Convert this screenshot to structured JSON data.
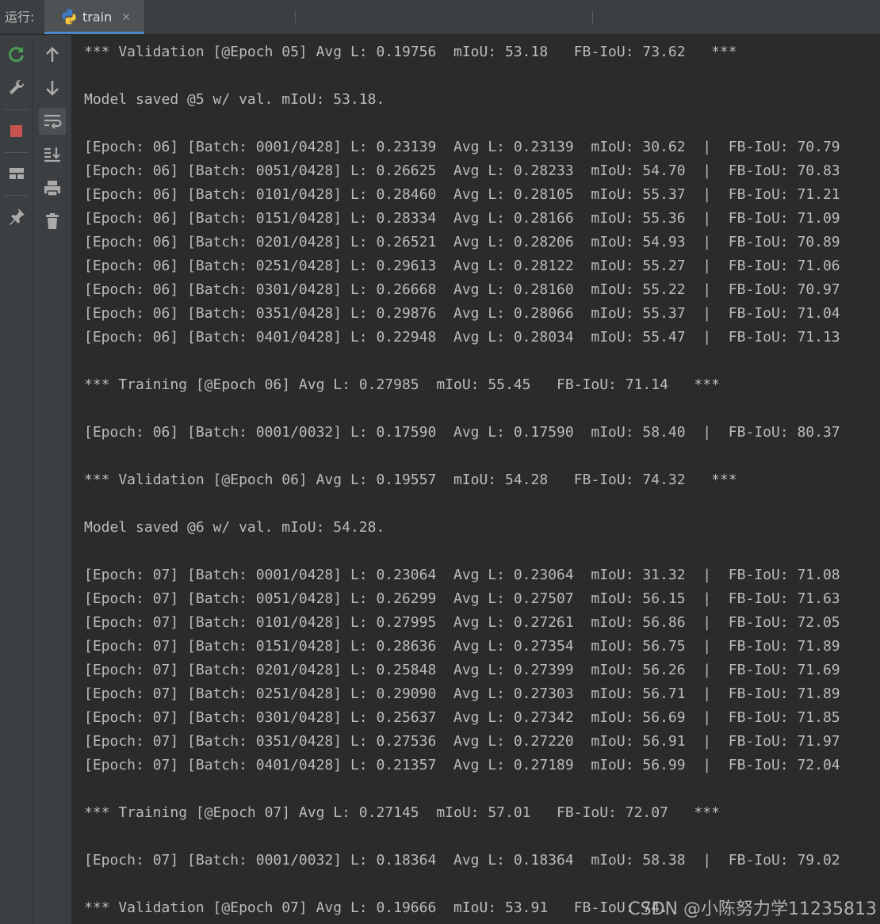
{
  "run_panel": {
    "label": "运行:",
    "tab": {
      "title": "train",
      "close": "×",
      "icon": "python-icon"
    }
  },
  "toolbar": {
    "left": [
      "rerun-icon",
      "wrench-icon",
      "stop-icon",
      "layout-icon",
      "pin-icon"
    ],
    "right": [
      "up-arrow-icon",
      "down-arrow-icon",
      "soft-wrap-icon",
      "scroll-to-end-icon",
      "print-icon",
      "trash-icon"
    ]
  },
  "console": {
    "lines": [
      "*** Validation [@Epoch 05] Avg L: 0.19756  mIoU: 53.18   FB-IoU: 73.62   ***",
      "",
      "Model saved @5 w/ val. mIoU: 53.18.",
      "",
      "[Epoch: 06] [Batch: 0001/0428] L: 0.23139  Avg L: 0.23139  mIoU: 30.62  |  FB-IoU: 70.79",
      "[Epoch: 06] [Batch: 0051/0428] L: 0.26625  Avg L: 0.28233  mIoU: 54.70  |  FB-IoU: 70.83",
      "[Epoch: 06] [Batch: 0101/0428] L: 0.28460  Avg L: 0.28105  mIoU: 55.37  |  FB-IoU: 71.21",
      "[Epoch: 06] [Batch: 0151/0428] L: 0.28334  Avg L: 0.28166  mIoU: 55.36  |  FB-IoU: 71.09",
      "[Epoch: 06] [Batch: 0201/0428] L: 0.26521  Avg L: 0.28206  mIoU: 54.93  |  FB-IoU: 70.89",
      "[Epoch: 06] [Batch: 0251/0428] L: 0.29613  Avg L: 0.28122  mIoU: 55.27  |  FB-IoU: 71.06",
      "[Epoch: 06] [Batch: 0301/0428] L: 0.26668  Avg L: 0.28160  mIoU: 55.22  |  FB-IoU: 70.97",
      "[Epoch: 06] [Batch: 0351/0428] L: 0.29876  Avg L: 0.28066  mIoU: 55.37  |  FB-IoU: 71.04",
      "[Epoch: 06] [Batch: 0401/0428] L: 0.22948  Avg L: 0.28034  mIoU: 55.47  |  FB-IoU: 71.13",
      "",
      "*** Training [@Epoch 06] Avg L: 0.27985  mIoU: 55.45   FB-IoU: 71.14   ***",
      "",
      "[Epoch: 06] [Batch: 0001/0032] L: 0.17590  Avg L: 0.17590  mIoU: 58.40  |  FB-IoU: 80.37",
      "",
      "*** Validation [@Epoch 06] Avg L: 0.19557  mIoU: 54.28   FB-IoU: 74.32   ***",
      "",
      "Model saved @6 w/ val. mIoU: 54.28.",
      "",
      "[Epoch: 07] [Batch: 0001/0428] L: 0.23064  Avg L: 0.23064  mIoU: 31.32  |  FB-IoU: 71.08",
      "[Epoch: 07] [Batch: 0051/0428] L: 0.26299  Avg L: 0.27507  mIoU: 56.15  |  FB-IoU: 71.63",
      "[Epoch: 07] [Batch: 0101/0428] L: 0.27995  Avg L: 0.27261  mIoU: 56.86  |  FB-IoU: 72.05",
      "[Epoch: 07] [Batch: 0151/0428] L: 0.28636  Avg L: 0.27354  mIoU: 56.75  |  FB-IoU: 71.89",
      "[Epoch: 07] [Batch: 0201/0428] L: 0.25848  Avg L: 0.27399  mIoU: 56.26  |  FB-IoU: 71.69",
      "[Epoch: 07] [Batch: 0251/0428] L: 0.29090  Avg L: 0.27303  mIoU: 56.71  |  FB-IoU: 71.89",
      "[Epoch: 07] [Batch: 0301/0428] L: 0.25637  Avg L: 0.27342  mIoU: 56.69  |  FB-IoU: 71.85",
      "[Epoch: 07] [Batch: 0351/0428] L: 0.27536  Avg L: 0.27220  mIoU: 56.91  |  FB-IoU: 71.97",
      "[Epoch: 07] [Batch: 0401/0428] L: 0.21357  Avg L: 0.27189  mIoU: 56.99  |  FB-IoU: 72.04",
      "",
      "*** Training [@Epoch 07] Avg L: 0.27145  mIoU: 57.01   FB-IoU: 72.07   ***",
      "",
      "[Epoch: 07] [Batch: 0001/0032] L: 0.18364  Avg L: 0.18364  mIoU: 58.38  |  FB-IoU: 79.02",
      "",
      "*** Validation [@Epoch 07] Avg L: 0.19666  mIoU: 53.91   FB-IoU: 74."
    ]
  },
  "watermark": "CSDN @小陈努力学11235813",
  "colors": {
    "console_bg": "#2b2b2b",
    "console_text": "#bbbbbb",
    "toolbar_bg": "#3c3f41",
    "tab_active_bg": "#4e5254",
    "tab_underline": "#4a88c7",
    "rerun_green": "#499c54",
    "stop_red": "#c75450"
  }
}
